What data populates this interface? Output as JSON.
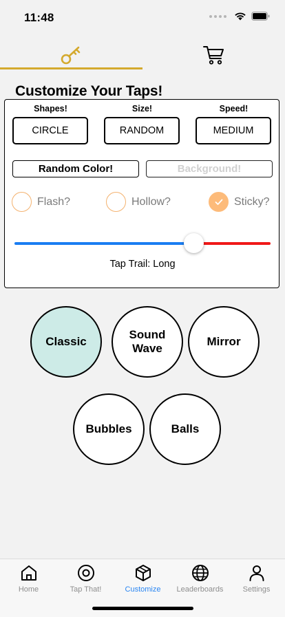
{
  "status": {
    "time": "11:48"
  },
  "top_tabs": [
    {
      "icon": "key-icon",
      "active": true,
      "accent": "#d4a92d"
    },
    {
      "icon": "cart-icon",
      "active": false
    }
  ],
  "title": "Customize Your Taps!",
  "panel": {
    "shapes": {
      "label": "Shapes!",
      "value": "CIRCLE"
    },
    "size": {
      "label": "Size!",
      "value": "RANDOM"
    },
    "speed": {
      "label": "Speed!",
      "value": "MEDIUM"
    },
    "random_color_label": "Random Color!",
    "background_label": "Background!",
    "options": [
      {
        "label": "Flash?",
        "checked": false
      },
      {
        "label": "Hollow?",
        "checked": false
      },
      {
        "label": "Sticky?",
        "checked": true
      }
    ],
    "slider": {
      "value": 0.7,
      "left_color": "#1a7df2",
      "right_color": "#f01818"
    },
    "trail_label": "Tap Trail: Long"
  },
  "modes": [
    {
      "label": "Classic",
      "selected": true
    },
    {
      "label": "Sound Wave",
      "selected": false
    },
    {
      "label": "Mirror",
      "selected": false
    },
    {
      "label": "Bubbles",
      "selected": false
    },
    {
      "label": "Balls",
      "selected": false
    }
  ],
  "tabbar": [
    {
      "label": "Home",
      "icon": "home-icon",
      "active": false
    },
    {
      "label": "Tap That!",
      "icon": "target-icon",
      "active": false
    },
    {
      "label": "Customize",
      "icon": "cube-icon",
      "active": true
    },
    {
      "label": "Leaderboards",
      "icon": "globe-icon",
      "active": false
    },
    {
      "label": "Settings",
      "icon": "person-icon",
      "active": false
    }
  ],
  "colors": {
    "accent": "#d4a92d",
    "selected_mode": "#cdebe7",
    "checkbox": "#fdbb7a",
    "tab_active": "#2a86f2"
  }
}
